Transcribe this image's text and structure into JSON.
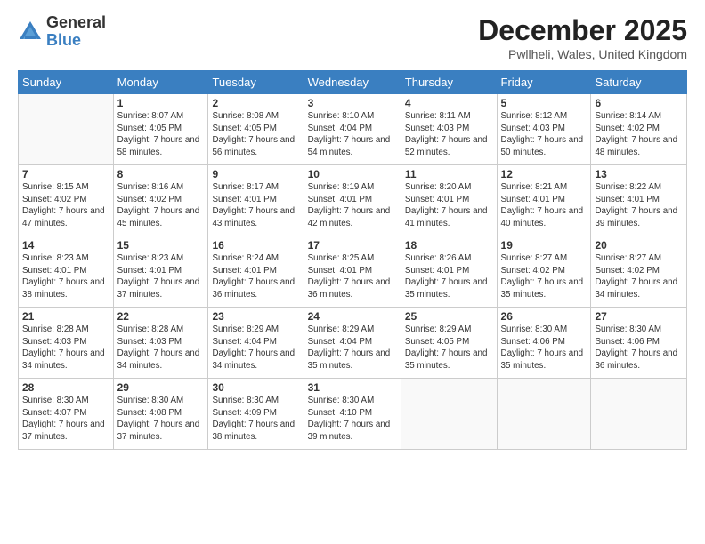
{
  "logo": {
    "general": "General",
    "blue": "Blue"
  },
  "header": {
    "title": "December 2025",
    "subtitle": "Pwllheli, Wales, United Kingdom"
  },
  "weekdays": [
    "Sunday",
    "Monday",
    "Tuesday",
    "Wednesday",
    "Thursday",
    "Friday",
    "Saturday"
  ],
  "weeks": [
    [
      {
        "day": "",
        "sunrise": "",
        "sunset": "",
        "daylight": ""
      },
      {
        "day": "1",
        "sunrise": "Sunrise: 8:07 AM",
        "sunset": "Sunset: 4:05 PM",
        "daylight": "Daylight: 7 hours and 58 minutes."
      },
      {
        "day": "2",
        "sunrise": "Sunrise: 8:08 AM",
        "sunset": "Sunset: 4:05 PM",
        "daylight": "Daylight: 7 hours and 56 minutes."
      },
      {
        "day": "3",
        "sunrise": "Sunrise: 8:10 AM",
        "sunset": "Sunset: 4:04 PM",
        "daylight": "Daylight: 7 hours and 54 minutes."
      },
      {
        "day": "4",
        "sunrise": "Sunrise: 8:11 AM",
        "sunset": "Sunset: 4:03 PM",
        "daylight": "Daylight: 7 hours and 52 minutes."
      },
      {
        "day": "5",
        "sunrise": "Sunrise: 8:12 AM",
        "sunset": "Sunset: 4:03 PM",
        "daylight": "Daylight: 7 hours and 50 minutes."
      },
      {
        "day": "6",
        "sunrise": "Sunrise: 8:14 AM",
        "sunset": "Sunset: 4:02 PM",
        "daylight": "Daylight: 7 hours and 48 minutes."
      }
    ],
    [
      {
        "day": "7",
        "sunrise": "Sunrise: 8:15 AM",
        "sunset": "Sunset: 4:02 PM",
        "daylight": "Daylight: 7 hours and 47 minutes."
      },
      {
        "day": "8",
        "sunrise": "Sunrise: 8:16 AM",
        "sunset": "Sunset: 4:02 PM",
        "daylight": "Daylight: 7 hours and 45 minutes."
      },
      {
        "day": "9",
        "sunrise": "Sunrise: 8:17 AM",
        "sunset": "Sunset: 4:01 PM",
        "daylight": "Daylight: 7 hours and 43 minutes."
      },
      {
        "day": "10",
        "sunrise": "Sunrise: 8:19 AM",
        "sunset": "Sunset: 4:01 PM",
        "daylight": "Daylight: 7 hours and 42 minutes."
      },
      {
        "day": "11",
        "sunrise": "Sunrise: 8:20 AM",
        "sunset": "Sunset: 4:01 PM",
        "daylight": "Daylight: 7 hours and 41 minutes."
      },
      {
        "day": "12",
        "sunrise": "Sunrise: 8:21 AM",
        "sunset": "Sunset: 4:01 PM",
        "daylight": "Daylight: 7 hours and 40 minutes."
      },
      {
        "day": "13",
        "sunrise": "Sunrise: 8:22 AM",
        "sunset": "Sunset: 4:01 PM",
        "daylight": "Daylight: 7 hours and 39 minutes."
      }
    ],
    [
      {
        "day": "14",
        "sunrise": "Sunrise: 8:23 AM",
        "sunset": "Sunset: 4:01 PM",
        "daylight": "Daylight: 7 hours and 38 minutes."
      },
      {
        "day": "15",
        "sunrise": "Sunrise: 8:23 AM",
        "sunset": "Sunset: 4:01 PM",
        "daylight": "Daylight: 7 hours and 37 minutes."
      },
      {
        "day": "16",
        "sunrise": "Sunrise: 8:24 AM",
        "sunset": "Sunset: 4:01 PM",
        "daylight": "Daylight: 7 hours and 36 minutes."
      },
      {
        "day": "17",
        "sunrise": "Sunrise: 8:25 AM",
        "sunset": "Sunset: 4:01 PM",
        "daylight": "Daylight: 7 hours and 36 minutes."
      },
      {
        "day": "18",
        "sunrise": "Sunrise: 8:26 AM",
        "sunset": "Sunset: 4:01 PM",
        "daylight": "Daylight: 7 hours and 35 minutes."
      },
      {
        "day": "19",
        "sunrise": "Sunrise: 8:27 AM",
        "sunset": "Sunset: 4:02 PM",
        "daylight": "Daylight: 7 hours and 35 minutes."
      },
      {
        "day": "20",
        "sunrise": "Sunrise: 8:27 AM",
        "sunset": "Sunset: 4:02 PM",
        "daylight": "Daylight: 7 hours and 34 minutes."
      }
    ],
    [
      {
        "day": "21",
        "sunrise": "Sunrise: 8:28 AM",
        "sunset": "Sunset: 4:03 PM",
        "daylight": "Daylight: 7 hours and 34 minutes."
      },
      {
        "day": "22",
        "sunrise": "Sunrise: 8:28 AM",
        "sunset": "Sunset: 4:03 PM",
        "daylight": "Daylight: 7 hours and 34 minutes."
      },
      {
        "day": "23",
        "sunrise": "Sunrise: 8:29 AM",
        "sunset": "Sunset: 4:04 PM",
        "daylight": "Daylight: 7 hours and 34 minutes."
      },
      {
        "day": "24",
        "sunrise": "Sunrise: 8:29 AM",
        "sunset": "Sunset: 4:04 PM",
        "daylight": "Daylight: 7 hours and 35 minutes."
      },
      {
        "day": "25",
        "sunrise": "Sunrise: 8:29 AM",
        "sunset": "Sunset: 4:05 PM",
        "daylight": "Daylight: 7 hours and 35 minutes."
      },
      {
        "day": "26",
        "sunrise": "Sunrise: 8:30 AM",
        "sunset": "Sunset: 4:06 PM",
        "daylight": "Daylight: 7 hours and 35 minutes."
      },
      {
        "day": "27",
        "sunrise": "Sunrise: 8:30 AM",
        "sunset": "Sunset: 4:06 PM",
        "daylight": "Daylight: 7 hours and 36 minutes."
      }
    ],
    [
      {
        "day": "28",
        "sunrise": "Sunrise: 8:30 AM",
        "sunset": "Sunset: 4:07 PM",
        "daylight": "Daylight: 7 hours and 37 minutes."
      },
      {
        "day": "29",
        "sunrise": "Sunrise: 8:30 AM",
        "sunset": "Sunset: 4:08 PM",
        "daylight": "Daylight: 7 hours and 37 minutes."
      },
      {
        "day": "30",
        "sunrise": "Sunrise: 8:30 AM",
        "sunset": "Sunset: 4:09 PM",
        "daylight": "Daylight: 7 hours and 38 minutes."
      },
      {
        "day": "31",
        "sunrise": "Sunrise: 8:30 AM",
        "sunset": "Sunset: 4:10 PM",
        "daylight": "Daylight: 7 hours and 39 minutes."
      },
      {
        "day": "",
        "sunrise": "",
        "sunset": "",
        "daylight": ""
      },
      {
        "day": "",
        "sunrise": "",
        "sunset": "",
        "daylight": ""
      },
      {
        "day": "",
        "sunrise": "",
        "sunset": "",
        "daylight": ""
      }
    ]
  ]
}
